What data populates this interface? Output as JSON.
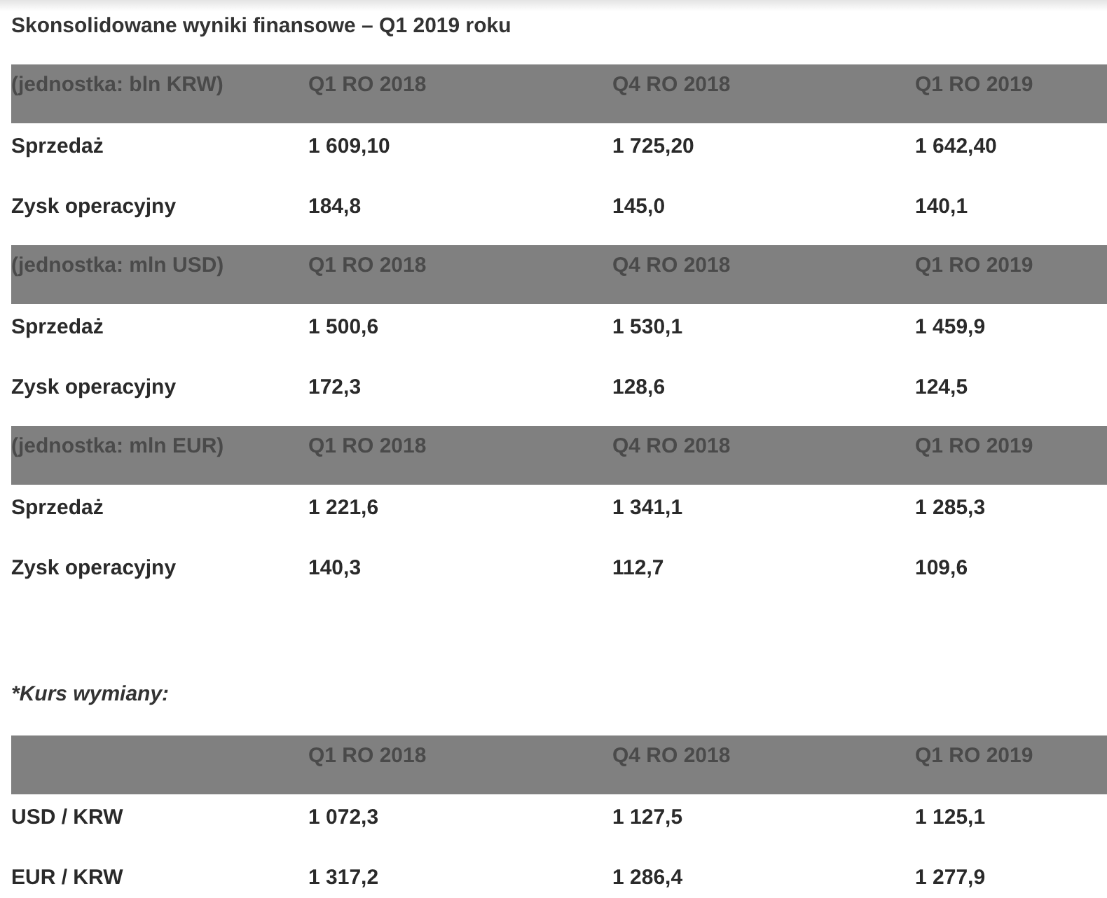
{
  "title": "Skonsolidowane wyniki finansowe – Q1 2019 roku",
  "tables": [
    {
      "header": [
        "(jednostka: bln KRW)",
        "Q1 RO 2018",
        "Q4 RO 2018",
        "Q1 RO 2019"
      ],
      "rows": [
        [
          "Sprzedaż",
          "1 609,10",
          "1 725,20",
          "1 642,40"
        ],
        [
          "Zysk operacyjny",
          "184,8",
          "145,0",
          "140,1"
        ]
      ]
    },
    {
      "header": [
        "(jednostka: mln USD)",
        "Q1 RO 2018",
        "Q4 RO 2018",
        "Q1 RO 2019"
      ],
      "rows": [
        [
          "Sprzedaż",
          "1 500,6",
          "1 530,1",
          "1 459,9"
        ],
        [
          "Zysk operacyjny",
          "172,3",
          "128,6",
          "124,5"
        ]
      ]
    },
    {
      "header": [
        "(jednostka: mln EUR)",
        "Q1 RO 2018",
        "Q4 RO 2018",
        "Q1 RO 2019"
      ],
      "rows": [
        [
          "Sprzedaż",
          "1 221,6",
          "1 341,1",
          "1 285,3"
        ],
        [
          "Zysk operacyjny",
          "140,3",
          "112,7",
          "109,6"
        ]
      ]
    }
  ],
  "footnote": "*Kurs wymiany:",
  "exchange": {
    "header": [
      "Q1 RO 2018",
      "Q4 RO 2018",
      "Q1 RO 2019"
    ],
    "rows": [
      [
        "USD / KRW",
        "1 072,3",
        "1 127,5",
        "1 125,1"
      ],
      [
        "EUR / KRW",
        "1 317,2",
        "1 286,4",
        "1 277,9"
      ]
    ]
  }
}
